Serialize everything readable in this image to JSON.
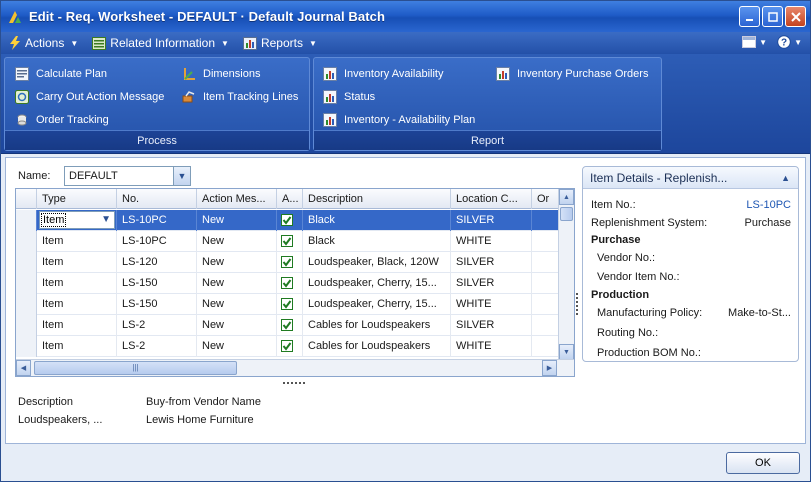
{
  "window": {
    "title": "Edit - Req. Worksheet - DEFAULT · Default Journal Batch"
  },
  "menubar": {
    "items": [
      "Actions",
      "Related Information",
      "Reports"
    ]
  },
  "ribbon": {
    "process": {
      "label": "Process",
      "items": [
        "Calculate Plan",
        "Carry Out Action Message",
        "Order Tracking",
        "Dimensions",
        "Item Tracking Lines"
      ]
    },
    "report": {
      "label": "Report",
      "items": [
        "Inventory Availability",
        "Status",
        "Inventory - Availability Plan",
        "Inventory Purchase Orders"
      ]
    }
  },
  "name_field": {
    "label": "Name:",
    "value": "DEFAULT"
  },
  "grid": {
    "columns": [
      "Type",
      "No.",
      "Action Mes...",
      "A...",
      "Description",
      "Location C...",
      "Or"
    ],
    "rows": [
      {
        "type": "Item",
        "no": "LS-10PC",
        "action": "New",
        "accept": true,
        "description": "Black",
        "location": "SILVER"
      },
      {
        "type": "Item",
        "no": "LS-10PC",
        "action": "New",
        "accept": true,
        "description": "Black",
        "location": "WHITE"
      },
      {
        "type": "Item",
        "no": "LS-120",
        "action": "New",
        "accept": true,
        "description": "Loudspeaker, Black, 120W",
        "location": "SILVER"
      },
      {
        "type": "Item",
        "no": "LS-150",
        "action": "New",
        "accept": true,
        "description": "Loudspeaker, Cherry, 15...",
        "location": "SILVER"
      },
      {
        "type": "Item",
        "no": "LS-150",
        "action": "New",
        "accept": true,
        "description": "Loudspeaker, Cherry, 15...",
        "location": "WHITE"
      },
      {
        "type": "Item",
        "no": "LS-2",
        "action": "New",
        "accept": true,
        "description": "Cables for Loudspeakers",
        "location": "SILVER"
      },
      {
        "type": "Item",
        "no": "LS-2",
        "action": "New",
        "accept": true,
        "description": "Cables for Loudspeakers",
        "location": "WHITE"
      }
    ]
  },
  "details": {
    "description_label": "Description",
    "vendor_label": "Buy-from Vendor Name",
    "description_value": "Loudspeakers, ...",
    "vendor_value": "Lewis Home Furniture"
  },
  "factbox": {
    "title": "Item Details - Replenish...",
    "item_no_label": "Item No.:",
    "item_no_value": "LS-10PC",
    "replenishment_label": "Replenishment System:",
    "replenishment_value": "Purchase",
    "purchase_heading": "Purchase",
    "vendor_no_label": "Vendor No.:",
    "vendor_item_no_label": "Vendor Item No.:",
    "production_heading": "Production",
    "manufacturing_policy_label": "Manufacturing Policy:",
    "manufacturing_policy_value": "Make-to-St...",
    "routing_no_label": "Routing No.:",
    "production_bom_label": "Production BOM No.:"
  },
  "footer": {
    "ok_label": "OK"
  },
  "colors": {
    "accent": "#2350a8",
    "selection": "#3568c8",
    "link": "#1f57b3"
  }
}
